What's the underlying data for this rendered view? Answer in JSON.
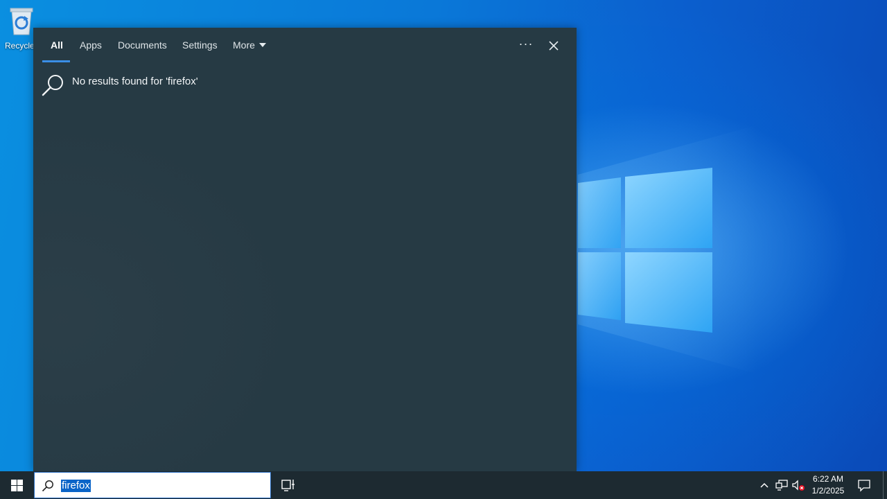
{
  "desktop": {
    "icons": [
      {
        "label": "Recycle",
        "icon": "recycle-bin-icon"
      }
    ]
  },
  "search_flyout": {
    "tabs": [
      {
        "label": "All",
        "active": true
      },
      {
        "label": "Apps",
        "active": false
      },
      {
        "label": "Documents",
        "active": false
      },
      {
        "label": "Settings",
        "active": false
      },
      {
        "label": "More",
        "active": false,
        "has_dropdown": true
      }
    ],
    "more_options_icon": "ellipsis-icon",
    "close_icon": "close-icon",
    "message": "No results found for 'firefox'",
    "message_icon": "search-icon"
  },
  "taskbar": {
    "start_icon": "windows-logo-icon",
    "search": {
      "value": "firefox",
      "icon": "search-icon"
    },
    "task_view_icon": "task-view-icon",
    "tray": {
      "show_hidden_icon": "chevron-up-icon",
      "network_icon": "network-icon",
      "volume_icon": "volume-muted-icon"
    },
    "clock": {
      "time": "6:22 AM",
      "date": "1/2/2025"
    },
    "notifications_icon": "action-center-icon"
  },
  "colors": {
    "flyout_bg": "#263a44",
    "taskbar_bg": "#1d2a31",
    "accent": "#3a8ee6",
    "selection": "#0a64c8"
  }
}
